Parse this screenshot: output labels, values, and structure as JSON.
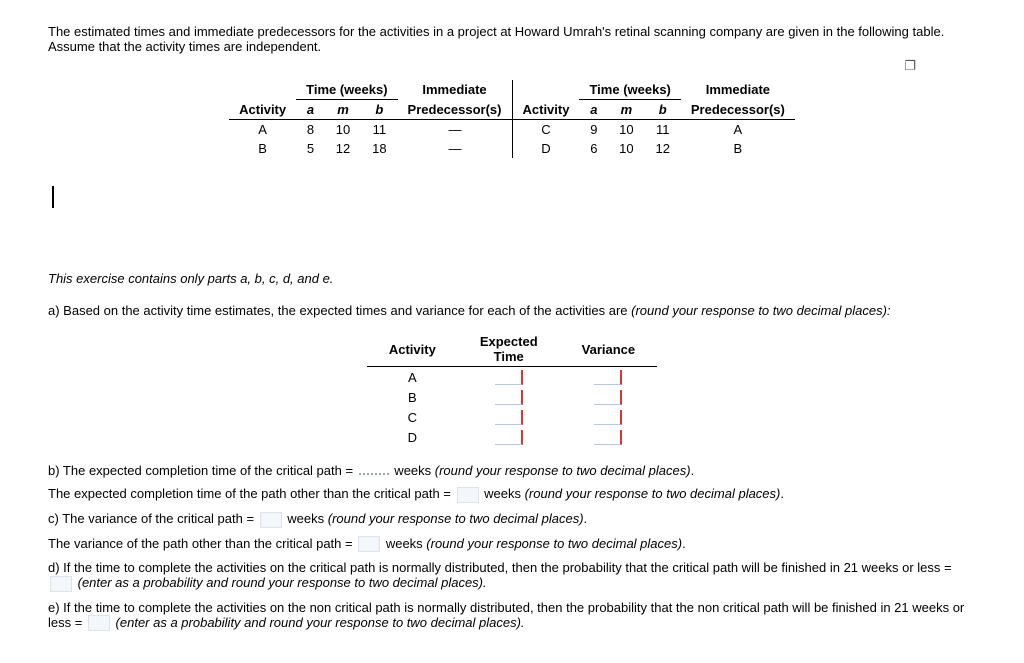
{
  "intro": "The estimated times and immediate predecessors for the activities in a project at Howard Umrah's retinal scanning company are given in the following table. Assume that the activity times are independent.",
  "headers": {
    "activity": "Activity",
    "time_group": "Time (weeks)",
    "a": "a",
    "m": "m",
    "b": "b",
    "immediate": "Immediate",
    "predecessors": "Predecessor(s)"
  },
  "left_rows": [
    {
      "act": "A",
      "a": "8",
      "m": "10",
      "b": "11",
      "pred": "—"
    },
    {
      "act": "B",
      "a": "5",
      "m": "12",
      "b": "18",
      "pred": "—"
    }
  ],
  "right_rows": [
    {
      "act": "C",
      "a": "9",
      "m": "10",
      "b": "11",
      "pred": "A"
    },
    {
      "act": "D",
      "a": "6",
      "m": "10",
      "b": "12",
      "pred": "B"
    }
  ],
  "parts_note": "This exercise contains only parts a, b, c, d, and e.",
  "a_prompt": "a) Based on the activity time estimates, the expected times and variance for each of the activities are ",
  "round2": "(round your response to two decimal places)",
  "round2_colon": "(round your response to two decimal places):",
  "ans_headers": {
    "activity": "Activity",
    "expected": "Expected\nTime",
    "variance": "Variance"
  },
  "ans_rows": [
    "A",
    "B",
    "C",
    "D"
  ],
  "b1_pre": "b) The expected completion time of the critical path = ",
  "b1_post": " weeks ",
  "b2_pre": "The expected completion time of the path other than the critical path = ",
  "b2_post": " weeks ",
  "c1_pre": "c) The variance of the critical path = ",
  "c1_post": " weeks ",
  "c2_pre": "The variance of the path other than the critical path = ",
  "c2_post": " weeks ",
  "d_pre": "d) If the time to complete the activities on the critical path is normally distributed, then the probability that the critical path will be finished in 21 weeks or less = ",
  "d_post": " (enter as a probability and round your response to two decimal places).",
  "e_pre": "e) If the time to complete the activities on the non critical path is normally distributed, then the probability that the non critical path will be finished in 21 weeks or less = ",
  "e_post": " (enter as a probability and round your response to two decimal places).",
  "period": "."
}
